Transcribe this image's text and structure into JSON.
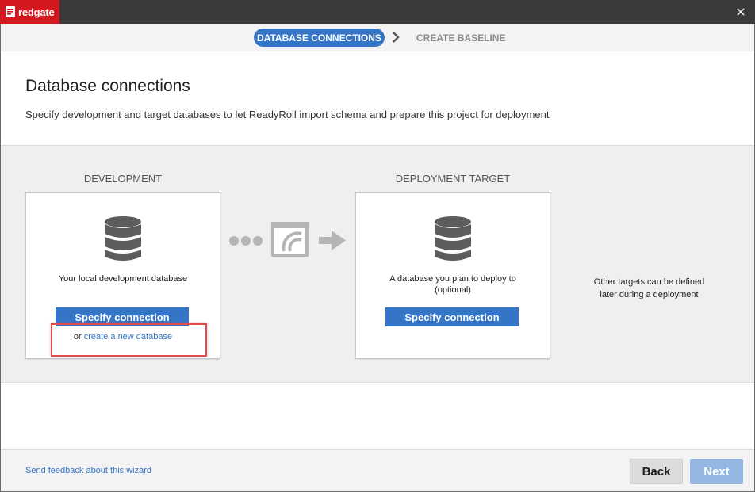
{
  "app": {
    "logo_text": "redgate"
  },
  "steps": {
    "active": "DATABASE CONNECTIONS",
    "next": "CREATE BASELINE"
  },
  "header": {
    "title": "Database connections",
    "subtitle": "Specify development and target databases to let ReadyRoll import schema and prepare this project for deployment"
  },
  "development": {
    "heading": "DEVELOPMENT",
    "description": "Your local development database",
    "button_label": "Specify connection",
    "alt_prefix": "or",
    "alt_link": "create a new database"
  },
  "deployment": {
    "heading": "DEPLOYMENT TARGET",
    "description_line1": "A database you plan to deploy to",
    "description_line2": "(optional)",
    "button_label": "Specify connection"
  },
  "other_targets": {
    "line1": "Other targets can be defined",
    "line2": "later during a deployment"
  },
  "footer": {
    "feedback": "Send feedback about this wizard",
    "back": "Back",
    "next": "Next"
  },
  "colors": {
    "accent": "#3575c8",
    "brand": "#d4181f",
    "highlight": "#e14b4b",
    "disabled_button": "#93b6e3"
  },
  "icons": [
    "redgate-logo-icon",
    "close-icon",
    "chevron-right-icon",
    "database-icon",
    "dots-icon",
    "readyroll-icon",
    "arrow-right-icon"
  ]
}
